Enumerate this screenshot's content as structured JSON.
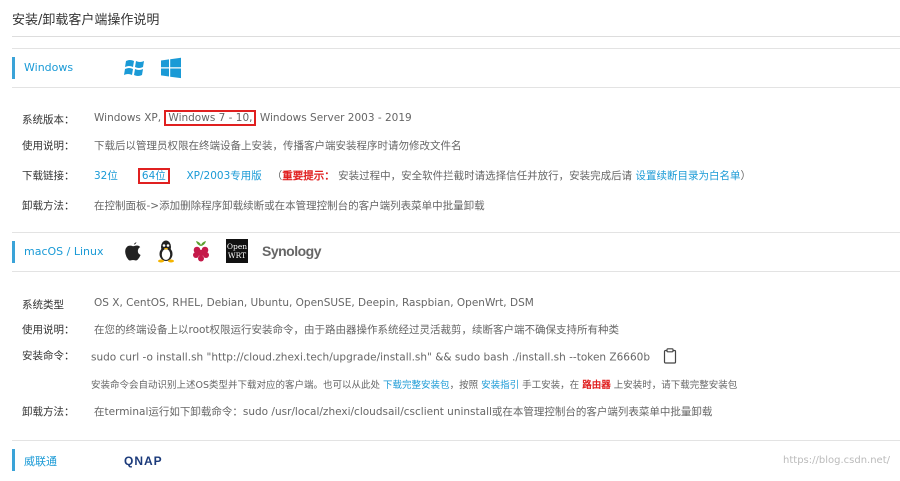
{
  "page_title": "安装/卸载客户端操作说明",
  "windows": {
    "label": "Windows",
    "rows": {
      "version_label": "系统版本：",
      "version_a": "Windows XP,",
      "version_b": "Windows 7 - 10,",
      "version_c": "Windows Server 2003 - 2019",
      "usage_label": "使用说明：",
      "usage_text": "下载后以管理员权限在终端设备上安装，传播客户端安装程序时请勿修改文件名",
      "download_label": "下载链接：",
      "link_32": "32位",
      "link_64": "64位",
      "link_xp": "XP/2003专用版",
      "tip_open": "（",
      "tip_label": "重要提示：",
      "tip_text": "安装过程中，安全软件拦截时请选择信任并放行，安装完成后请",
      "tip_link": "设置续断目录为白名单",
      "tip_close": "）",
      "uninstall_label": "卸载方法：",
      "uninstall_text": "在控制面板->添加删除程序卸载续断或在本管理控制台的客户端列表菜单中批量卸载"
    }
  },
  "mac_linux": {
    "label": "macOS / Linux",
    "icons": [
      "apple-icon",
      "linux-tux-icon",
      "raspberry-pi-icon",
      "openwrt-icon",
      "synology-logo"
    ],
    "openwrt_text_1": "Open",
    "openwrt_text_2": "WRT",
    "synology_text": "Synology",
    "rows": {
      "type_label": "系统类型",
      "type_text": "OS X, CentOS, RHEL, Debian, Ubuntu, OpenSUSE, Deepin, Raspbian, OpenWrt, DSM",
      "usage_label": "使用说明：",
      "usage_text": "在您的终端设备上以root权限运行安装命令，由于路由器操作系统经过灵活裁剪，续断客户端不确保支持所有种类",
      "install_label": "安装命令：",
      "install_cmd": "sudo curl -o install.sh \"http://cloud.zhexi.tech/upgrade/install.sh\" && sudo bash ./install.sh --token Z6660b",
      "note_a": "安装命令会自动识别上述OS类型并下载对应的客户端。也可以从此处",
      "note_link1": "下载完整安装包",
      "note_b": "，按照",
      "note_link2": "安装指引",
      "note_c": "手工安装，在",
      "note_router": "路由器",
      "note_d": "上安装时，请下载完整安装包",
      "uninstall_label": "卸载方法：",
      "uninstall_text": "在terminal运行如下卸载命令：sudo /usr/local/zhexi/cloudsail/csclient uninstall或在本管理控制台的客户端列表菜单中批量卸载"
    }
  },
  "qnap": {
    "label": "威联通",
    "logo_text": "QNAP"
  },
  "watermark": "https://blog.csdn.net/"
}
